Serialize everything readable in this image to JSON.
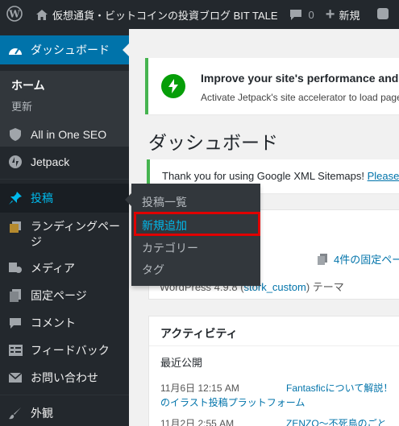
{
  "adminbar": {
    "site_title": "仮想通貨・ビットコインの投資ブログ BIT TALE",
    "comments_count": "0",
    "new_label": "新規",
    "icons": {
      "wp": "wordpress-logo-icon",
      "home": "home-icon",
      "comment": "comment-bubble-icon",
      "plus": "plus-icon"
    }
  },
  "sidebar": {
    "dashboard_label": "ダッシュボード",
    "home_label": "ホーム",
    "update_label": "更新",
    "items": [
      {
        "label": "All in One SEO",
        "icon": "shield-icon"
      },
      {
        "label": "Jetpack",
        "icon": "jetpack-bolt-icon"
      },
      {
        "label": "投稿",
        "icon": "pushpin-icon"
      },
      {
        "label": "ランディングページ",
        "icon": "pages-stack-icon"
      },
      {
        "label": "メディア",
        "icon": "media-icon"
      },
      {
        "label": "固定ページ",
        "icon": "page-icon"
      },
      {
        "label": "コメント",
        "icon": "comment-icon"
      },
      {
        "label": "フィードバック",
        "icon": "feedback-icon"
      },
      {
        "label": "お問い合わせ",
        "icon": "mail-icon"
      },
      {
        "label": "外観",
        "icon": "paintbrush-icon"
      }
    ]
  },
  "flyout": {
    "items": [
      "投稿一覧",
      "新規追加",
      "カテゴリー",
      "タグ"
    ]
  },
  "main": {
    "jetpack_notice": {
      "title": "Improve your site's performance and sp",
      "subtitle": "Activate Jetpack's site accelerator to load page"
    },
    "page_title": "ダッシュボード",
    "sitemap_notice": {
      "text": "Thank you for using Google XML Sitemaps!",
      "link": "Please"
    },
    "glance": {
      "pages_link": "4件の固定ペー",
      "theme_prefix": "WordPress 4.9.8 (",
      "theme_link": "stork_custom",
      "theme_suffix": ") テーマ"
    },
    "activity": {
      "title": "アクティビティ",
      "subtitle": "最近公開",
      "rows": [
        {
          "date": "11月6日 12:15 AM",
          "link": "Fantasficについて解説！",
          "link2": "のイラスト投稿プラットフォーム"
        },
        {
          "date": "11月2日 2:55 AM",
          "link": "ZENZO～不死鳥のごと"
        }
      ]
    }
  },
  "colors": {
    "accent": "#0073aa",
    "sidebar": "#23282d",
    "highlight": "#e00000",
    "notice_green": "#46b450"
  }
}
